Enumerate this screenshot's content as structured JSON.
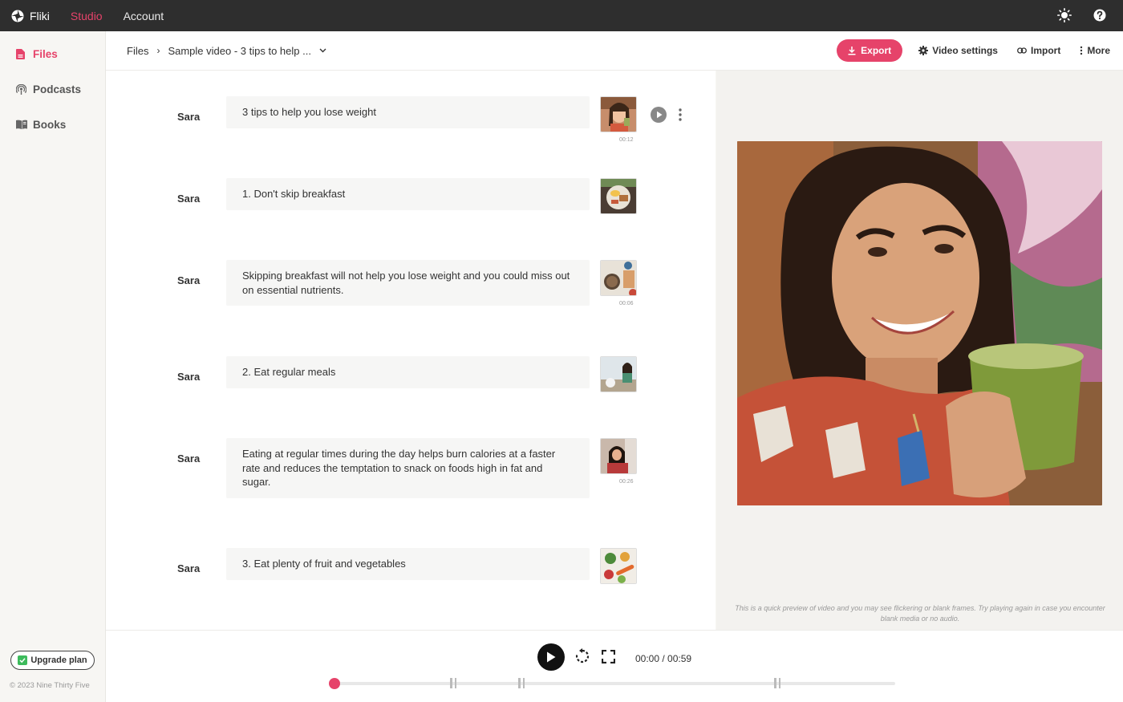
{
  "app": {
    "name": "Fliki"
  },
  "topnav": [
    {
      "label": "Studio",
      "active": true
    },
    {
      "label": "Account",
      "active": false
    }
  ],
  "sidebar": {
    "items": [
      {
        "label": "Files",
        "icon": "file-icon",
        "active": true
      },
      {
        "label": "Podcasts",
        "icon": "podcast-icon",
        "active": false
      },
      {
        "label": "Books",
        "icon": "book-icon",
        "active": false
      }
    ],
    "upgrade_label": "Upgrade plan",
    "copyright": "© 2023 Nine Thirty Five"
  },
  "breadcrumb": {
    "root": "Files",
    "current": "Sample video - 3 tips to help ..."
  },
  "actions": {
    "export": "Export",
    "video_settings": "Video settings",
    "import": "Import",
    "more": "More"
  },
  "scenes": [
    {
      "speaker": "Sara",
      "text": "3 tips to help you lose weight",
      "duration": "00:12"
    },
    {
      "speaker": "Sara",
      "text": "1. Don't skip breakfast",
      "duration": ""
    },
    {
      "speaker": "Sara",
      "text": "Skipping breakfast will not help you lose weight and you could miss out on essential nutrients.",
      "duration": "00:06"
    },
    {
      "speaker": "Sara",
      "text": "2. Eat regular meals",
      "duration": ""
    },
    {
      "speaker": "Sara",
      "text": "Eating at regular times during the day helps burn calories at a faster rate and reduces the temptation to snack on foods high in fat and sugar.",
      "duration": "00:26"
    },
    {
      "speaker": "Sara",
      "text": "3. Eat plenty of fruit and vegetables",
      "duration": ""
    }
  ],
  "preview": {
    "notice": "This is a quick preview of video and you may see flickering or blank frames. Try playing again in case you encounter blank media or no audio."
  },
  "player": {
    "time": "00:00 / 00:59",
    "progress": 0
  },
  "colors": {
    "accent": "#e6436a",
    "topbar": "#2e2e2e"
  }
}
